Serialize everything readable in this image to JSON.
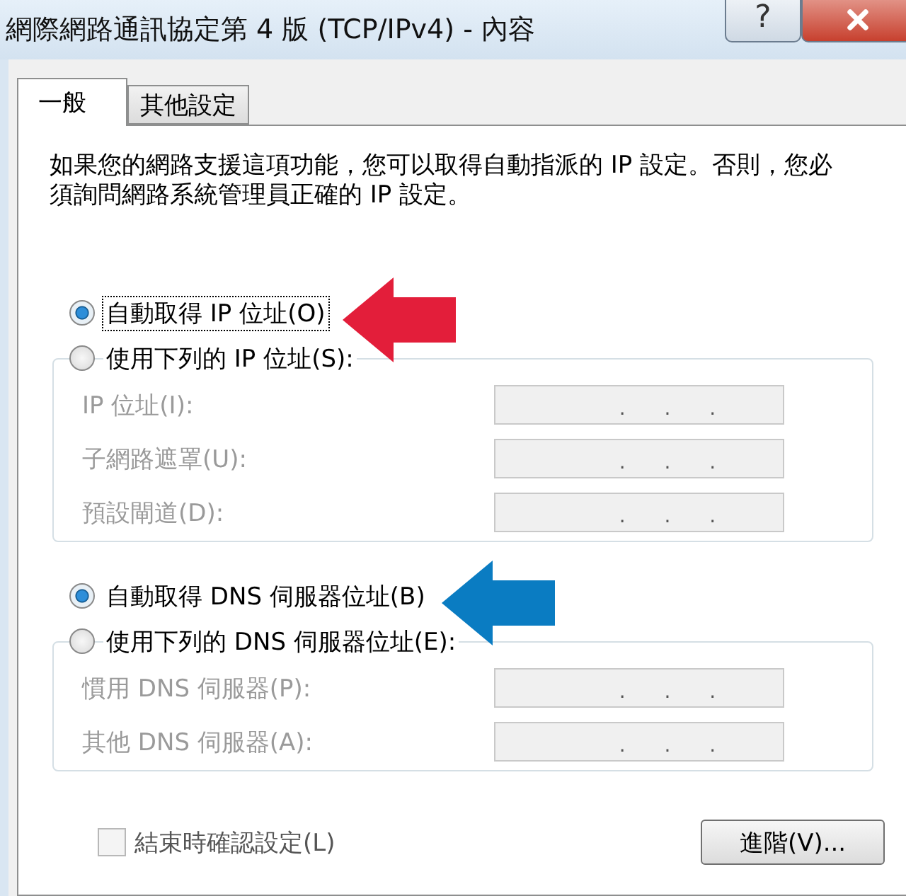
{
  "window": {
    "title": "網際網路通訊協定第 4 版 (TCP/IPv4) - 內容",
    "help": "?"
  },
  "tabs": [
    {
      "label": "一般",
      "selected": true
    },
    {
      "label": "其他設定",
      "selected": false
    }
  ],
  "description": "如果您的網路支援這項功能，您可以取得自動指派的 IP 設定。否則，您必須詢問網路系統管理員正確的 IP 設定。",
  "sections": [
    {
      "options": [
        {
          "label": "自動取得 IP 位址(O)",
          "selected": true,
          "focused": true,
          "color": "#e31e3a"
        },
        {
          "label": "使用下列的 IP 位址(S):",
          "selected": false,
          "focused": false
        }
      ],
      "fields": [
        {
          "label": "IP 位址(I):",
          "disabled": true,
          "separators": [
            ".",
            ".",
            "."
          ]
        },
        {
          "label": "子網路遮罩(U):",
          "disabled": true,
          "separators": [
            ".",
            ".",
            "."
          ]
        },
        {
          "label": "預設閘道(D):",
          "disabled": true,
          "separators": [
            ".",
            ".",
            "."
          ]
        }
      ]
    },
    {
      "options": [
        {
          "label": "自動取得 DNS 伺服器位址(B)",
          "selected": true,
          "focused": false,
          "color": "#0a7cc2"
        },
        {
          "label": "使用下列的 DNS 伺服器位址(E):",
          "selected": false,
          "focused": false
        }
      ],
      "fields": [
        {
          "label": "慣用 DNS 伺服器(P):",
          "disabled": true,
          "separators": [
            ".",
            ".",
            "."
          ]
        },
        {
          "label": "其他 DNS 伺服器(A):",
          "disabled": true,
          "separators": [
            ".",
            ".",
            "."
          ]
        }
      ]
    }
  ],
  "validate": {
    "label": "結束時確認設定(L)",
    "checked": false,
    "disabled": true
  },
  "advanced_button": "進階(V)..."
}
